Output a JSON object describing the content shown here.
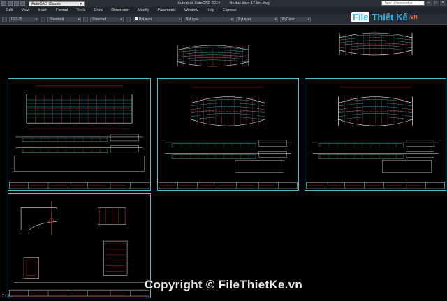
{
  "titlebar": {
    "workspace": "AutoCAD Classic",
    "app_name": "Autodesk AutoCAD 2014",
    "file_name": "Bv.duc dam 17.6m.dwg",
    "search_placeholder": "Type a keyword or phrase",
    "min": "–",
    "max": "□",
    "close": "×"
  },
  "menus": [
    "Edit",
    "View",
    "Insert",
    "Format",
    "Tools",
    "Draw",
    "Dimension",
    "Modify",
    "Parametric",
    "Window",
    "Help",
    "Express"
  ],
  "toolbar": {
    "dimstyle": "ISO-25",
    "textstyle": "Standard",
    "tablestyle": "Standard",
    "layer": "ByLayer",
    "linetype": "ByLayer",
    "lineweight": "ByLayer",
    "plotstyle": "ByColor"
  },
  "logo": {
    "file": "File",
    "thietke": "Thiết Kế",
    "vn": ".vn"
  },
  "watermark": "Copyright © FileThietKe.vn",
  "colors": {
    "sheet_border": "#3fc6d6",
    "drawing_red": "#e0242b",
    "drawing_white": "#e8e8e8",
    "drawing_cyan": "#45c8d6",
    "logo_blue": "#2fb7ea",
    "logo_orange": "#ff6a3a"
  }
}
